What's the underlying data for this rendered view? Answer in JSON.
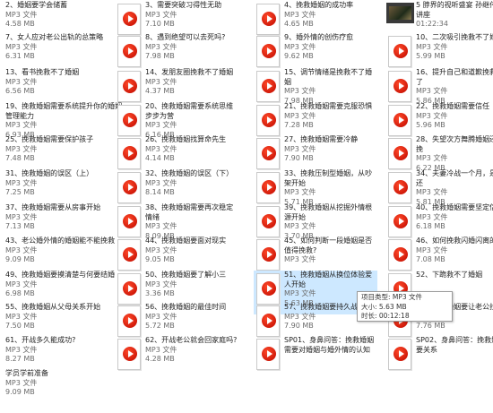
{
  "files": [
    {
      "name": "2、婚姻要学会储蓄",
      "type": "MP3 文件",
      "size": "4.58 MB",
      "icon": "none"
    },
    {
      "name": "3、需要突破习得性无助",
      "type": "MP3 文件",
      "size": "7.10 MB",
      "icon": "mp3-file-icon"
    },
    {
      "name": "4、挽救婚姻的成功率",
      "type": "MP3 文件",
      "size": "4.65 MB",
      "icon": "mp3-file-icon"
    },
    {
      "name": "5 脖界的视听盛宴 孙继伟合讲座",
      "type": "",
      "size": "01:22:34",
      "icon": "video-thumbnail"
    },
    {
      "name": "7、女人应对老公出轨的总策略",
      "type": "MP3 文件",
      "size": "6.31 MB",
      "icon": "none"
    },
    {
      "name": "8、遇到绝望可以去死吗?",
      "type": "MP3 文件",
      "size": "7.98 MB",
      "icon": "mp3-file-icon"
    },
    {
      "name": "9、婚外情的创伤疗愈",
      "type": "MP3 文件",
      "size": "9.62 MB",
      "icon": "mp3-file-icon"
    },
    {
      "name": "10、二次吸引挽救不了婚姻",
      "type": "MP3 文件",
      "size": "5.99 MB",
      "icon": "mp3-file-icon"
    },
    {
      "name": "13、看书挽救不了婚姻",
      "type": "MP3 文件",
      "size": "6.56 MB",
      "icon": "none"
    },
    {
      "name": "14、发朋友圈挽救不了婚姻",
      "type": "MP3 文件",
      "size": "4.37 MB",
      "icon": "mp3-file-icon"
    },
    {
      "name": "15、调节情绪是挽救不了婚姻",
      "type": "MP3 文件",
      "size": "7.98 MB",
      "icon": "mp3-file-icon"
    },
    {
      "name": "16、提升自己和道歉挽救不了",
      "type": "MP3 文件",
      "size": "5.86 MB",
      "icon": "mp3-file-icon"
    },
    {
      "name": "19、挽救婚姻需要系统提升你的婚姻管理能力",
      "type": "MP3 文件",
      "size": "6.93 MB",
      "icon": "none"
    },
    {
      "name": "20、挽救婚姻需要系统思维步步为营",
      "type": "MP3 文件",
      "size": "6.16 MB",
      "icon": "mp3-file-icon"
    },
    {
      "name": "21、挽救婚姻需要克服恐惧",
      "type": "MP3 文件",
      "size": "7.28 MB",
      "icon": "mp3-file-icon"
    },
    {
      "name": "22、挽救婚姻需要信任",
      "type": "MP3 文件",
      "size": "5.96 MB",
      "icon": "mp3-file-icon"
    },
    {
      "name": "25、挽救婚姻需要保护孩子",
      "type": "MP3 文件",
      "size": "7.48 MB",
      "icon": "none"
    },
    {
      "name": "26、挽救婚姻找算命先生",
      "type": "MP3 文件",
      "size": "4.14 MB",
      "icon": "mp3-file-icon"
    },
    {
      "name": "27、挽救婚姻需要冷静",
      "type": "MP3 文件",
      "size": "7.90 MB",
      "icon": "mp3-file-icon"
    },
    {
      "name": "28、失望次方舞腾婚姻还能挽",
      "type": "MP3 文件",
      "size": "6.22 MB",
      "icon": "mp3-file-icon"
    },
    {
      "name": "31、挽救婚姻的误区（上）",
      "type": "MP3 文件",
      "size": "7.25 MB",
      "icon": "none"
    },
    {
      "name": "32、挽救婚姻的误区（下）",
      "type": "MP3 文件",
      "size": "8.14 MB",
      "icon": "mp3-file-icon"
    },
    {
      "name": "33、挽救压制型婚姻，从吵架开始",
      "type": "MP3 文件",
      "size": "5.71 MB",
      "icon": "mp3-file-icon"
    },
    {
      "name": "34、夫妻冷战一个月，是否还",
      "type": "MP3 文件",
      "size": "5.81 MB",
      "icon": "mp3-file-icon"
    },
    {
      "name": "37、挽救婚姻需要从房事开始",
      "type": "MP3 文件",
      "size": "7.13 MB",
      "icon": "none"
    },
    {
      "name": "38、挽救婚姻需要再次稳定情绪",
      "type": "MP3 文件",
      "size": "8.09 MB",
      "icon": "mp3-file-icon"
    },
    {
      "name": "39、挽救婚姻从挖掘外情根源开始",
      "type": "MP3 文件",
      "size": "3.70 MB",
      "icon": "mp3-file-icon"
    },
    {
      "name": "40、挽救婚姻需要坚定信念",
      "type": "MP3 文件",
      "size": "6.18 MB",
      "icon": "mp3-file-icon"
    },
    {
      "name": "43、老公婚外情的婚姻能不能挽救",
      "type": "MP3 文件",
      "size": "9.09 MB",
      "icon": "none"
    },
    {
      "name": "44、挽救婚姻要面对现实",
      "type": "MP3 文件",
      "size": "9.05 MB",
      "icon": "mp3-file-icon"
    },
    {
      "name": "45、如何判断一段婚姻是否值得挽救?",
      "type": "MP3 文件",
      "size": "",
      "icon": "mp3-file-icon"
    },
    {
      "name": "46、如何挽救闪婚闪离的婚",
      "type": "MP3 文件",
      "size": "7.08 MB",
      "icon": "mp3-file-icon"
    },
    {
      "name": "49、挽救婚姻要摸清楚与何要结婚",
      "type": "MP3 文件",
      "size": "6.98 MB",
      "icon": "none"
    },
    {
      "name": "50、挽救婚姻要了解小三",
      "type": "MP3 文件",
      "size": "3.36 MB",
      "icon": "mp3-file-icon"
    },
    {
      "name": "51、挽救婚姻从换位体验爱人开始",
      "type": "MP3 文件",
      "size": "5.63 MB",
      "icon": "mp3-file-icon"
    },
    {
      "name": "52、下跪救不了婚姻",
      "type": "",
      "size": "",
      "icon": "mp3-file-icon"
    },
    {
      "name": "55、挽救婚姻从父母关系开始",
      "type": "MP3 文件",
      "size": "7.50 MB",
      "icon": "none"
    },
    {
      "name": "56、挽救婚姻的最佳时间",
      "type": "MP3 文件",
      "size": "5.72 MB",
      "icon": "mp3-file-icon"
    },
    {
      "name": "57、挽救婚姻要持久战",
      "type": "MP3 文件",
      "size": "7.90 MB",
      "icon": "mp3-file-icon"
    },
    {
      "name": "58、挽救婚姻要让老公找回",
      "type": "MP3 文件",
      "size": "7.76 MB",
      "icon": "mp3-file-icon"
    },
    {
      "name": "61、开战多久能成功?",
      "type": "MP3 文件",
      "size": "8.27 MB",
      "icon": "none"
    },
    {
      "name": "62、开战老公就会回家庭吗?",
      "type": "MP3 文件",
      "size": "4.28 MB",
      "icon": "mp3-file-icon"
    },
    {
      "name": "SP01、身鼻问答：挽救婚姻需要对婚姻与婚外情的认知",
      "type": "",
      "size": "",
      "icon": "mp3-file-icon"
    },
    {
      "name": "SP02、身鼻问答：挽救婚姻要关系",
      "type": "",
      "size": "",
      "icon": "mp3-file-icon"
    },
    {
      "name": "学员学前准备",
      "type": "MP3 文件",
      "size": "9.09 MB",
      "icon": "none"
    }
  ],
  "tooltip": {
    "line1": "项目类型: MP3 文件",
    "line2": "大小: 5.63 MB",
    "line3": "时长: 00:12:18"
  }
}
